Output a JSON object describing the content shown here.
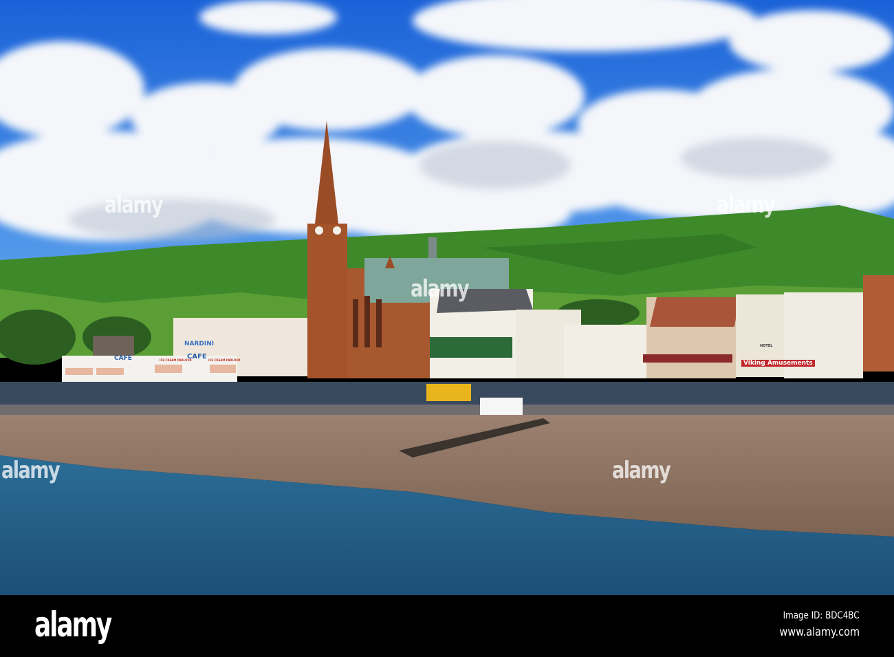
{
  "watermark": "alamy",
  "footer": {
    "logo": "alamy",
    "image_id": "Image ID: BDC4BC",
    "website": "www.alamy.com"
  },
  "signs": {
    "cafe_left": "CAFE",
    "cafe_right": "CAFE",
    "nardini": "NARDINI",
    "ice_cream_1": "ICE CREAM PARLOUR",
    "ice_cream_2": "ICE CREAM PARLOUR",
    "viking": "Viking Amusements",
    "hotel": "HOTEL"
  },
  "colors": {
    "sky": "#1f6fe0",
    "hill": "#3f8a2a",
    "church": "#a8552d",
    "beach": "#8a6e5c",
    "water": "#245f88"
  }
}
